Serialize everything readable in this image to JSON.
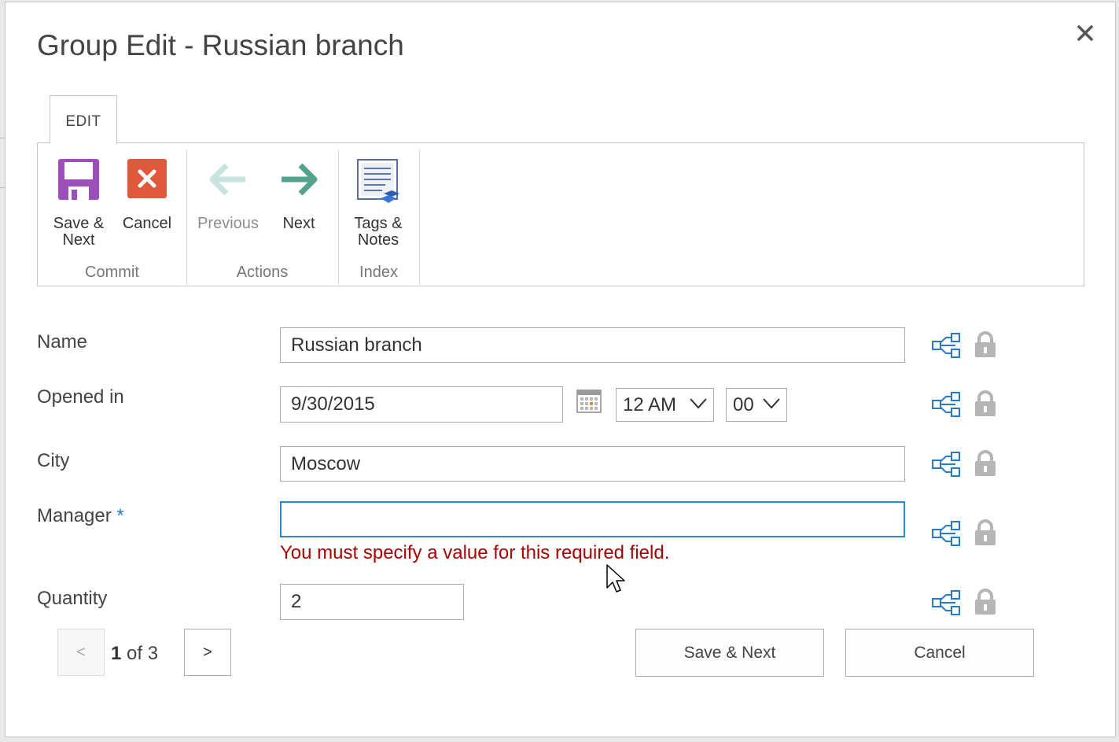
{
  "dialog": {
    "title": "Group Edit - Russian branch"
  },
  "ribbon": {
    "tab": "EDIT",
    "groups": [
      {
        "label": "Commit",
        "buttons": [
          {
            "label": "Save &\nNext",
            "icon": "floppy-disk-icon",
            "color": "#9b4fb8",
            "enabled": true
          },
          {
            "label": "Cancel",
            "icon": "red-x-icon",
            "color": "#e1583a",
            "enabled": true
          }
        ]
      },
      {
        "label": "Actions",
        "buttons": [
          {
            "label": "Previous",
            "icon": "arrow-left-icon",
            "color": "#c9e4de",
            "enabled": false
          },
          {
            "label": "Next",
            "icon": "arrow-right-icon",
            "color": "#53a28c",
            "enabled": true
          }
        ]
      },
      {
        "label": "Index",
        "buttons": [
          {
            "label": "Tags &\nNotes",
            "icon": "tags-notes-icon",
            "color": "#3b6fc4",
            "enabled": true
          }
        ]
      }
    ]
  },
  "form": {
    "name": {
      "label": "Name",
      "value": "Russian branch"
    },
    "opened_in": {
      "label": "Opened in",
      "date": "9/30/2015",
      "hour": "12 AM",
      "minute": "00"
    },
    "city": {
      "label": "City",
      "value": "Moscow"
    },
    "manager": {
      "label": "Manager",
      "required_mark": "*",
      "value": "",
      "error": "You must specify a value for this required field."
    },
    "quantity": {
      "label": "Quantity",
      "value": "2"
    }
  },
  "pager": {
    "prev": "<",
    "current": "1",
    "of_text": "of 3",
    "next": ">"
  },
  "footer": {
    "save_next": "Save & Next",
    "cancel": "Cancel"
  },
  "colors": {
    "accent": "#2b88d8",
    "error": "#a80000",
    "required": "#2b79c4"
  }
}
